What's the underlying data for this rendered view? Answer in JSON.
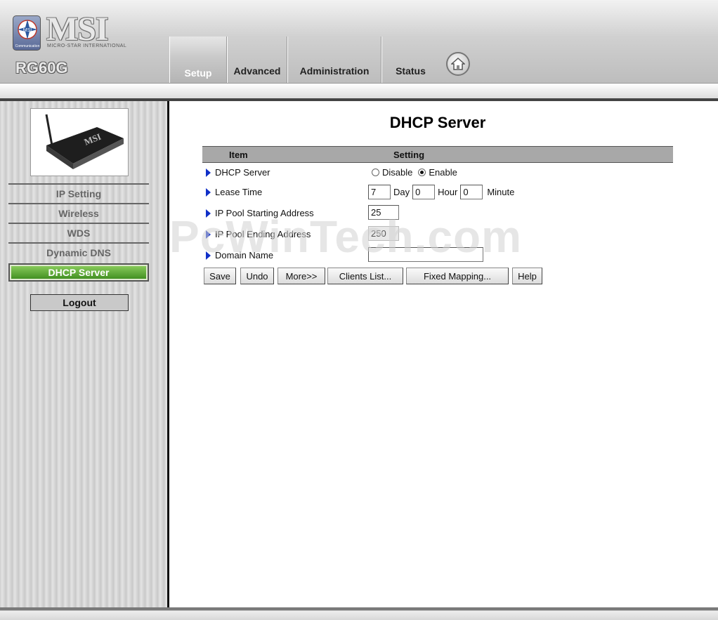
{
  "brand": {
    "badge_text": "Communication",
    "logo_word": "MSI",
    "logo_sub": "MICRO-STAR INTERNATIONAL",
    "model": "RG60G"
  },
  "tabs": [
    {
      "label": "Setup",
      "active": true
    },
    {
      "label": "Advanced"
    },
    {
      "label": "Administration"
    },
    {
      "label": "Status"
    }
  ],
  "sidebar": {
    "items": [
      {
        "label": "IP Setting"
      },
      {
        "label": "Wireless"
      },
      {
        "label": "WDS"
      },
      {
        "label": "Dynamic DNS"
      },
      {
        "label": "DHCP Server",
        "active": true
      }
    ],
    "logout_label": "Logout",
    "device_label": "MSI"
  },
  "main": {
    "title": "DHCP Server",
    "col_item": "Item",
    "col_setting": "Setting",
    "rows": {
      "dhcp_server": {
        "label": "DHCP Server",
        "opt_disable": "Disable",
        "opt_enable": "Enable",
        "selected": "Enable"
      },
      "lease_time": {
        "label": "Lease Time",
        "day_value": "7",
        "day_unit": "Day",
        "hour_value": "0",
        "hour_unit": "Hour",
        "minute_value": "0",
        "minute_unit": "Minute"
      },
      "pool_start": {
        "label": "IP Pool Starting Address",
        "value": "25"
      },
      "pool_end": {
        "label": "IP Pool Ending Address",
        "value": "250"
      },
      "domain": {
        "label": "Domain Name",
        "value": ""
      }
    },
    "buttons": {
      "save": "Save",
      "undo": "Undo",
      "more": "More>>",
      "clients": "Clients List...",
      "fixed": "Fixed Mapping...",
      "help": "Help"
    }
  },
  "watermark": "PcWinTech.com",
  "colors": {
    "accent_green": "#3b8a1c",
    "bullet_blue": "#1030c8"
  }
}
